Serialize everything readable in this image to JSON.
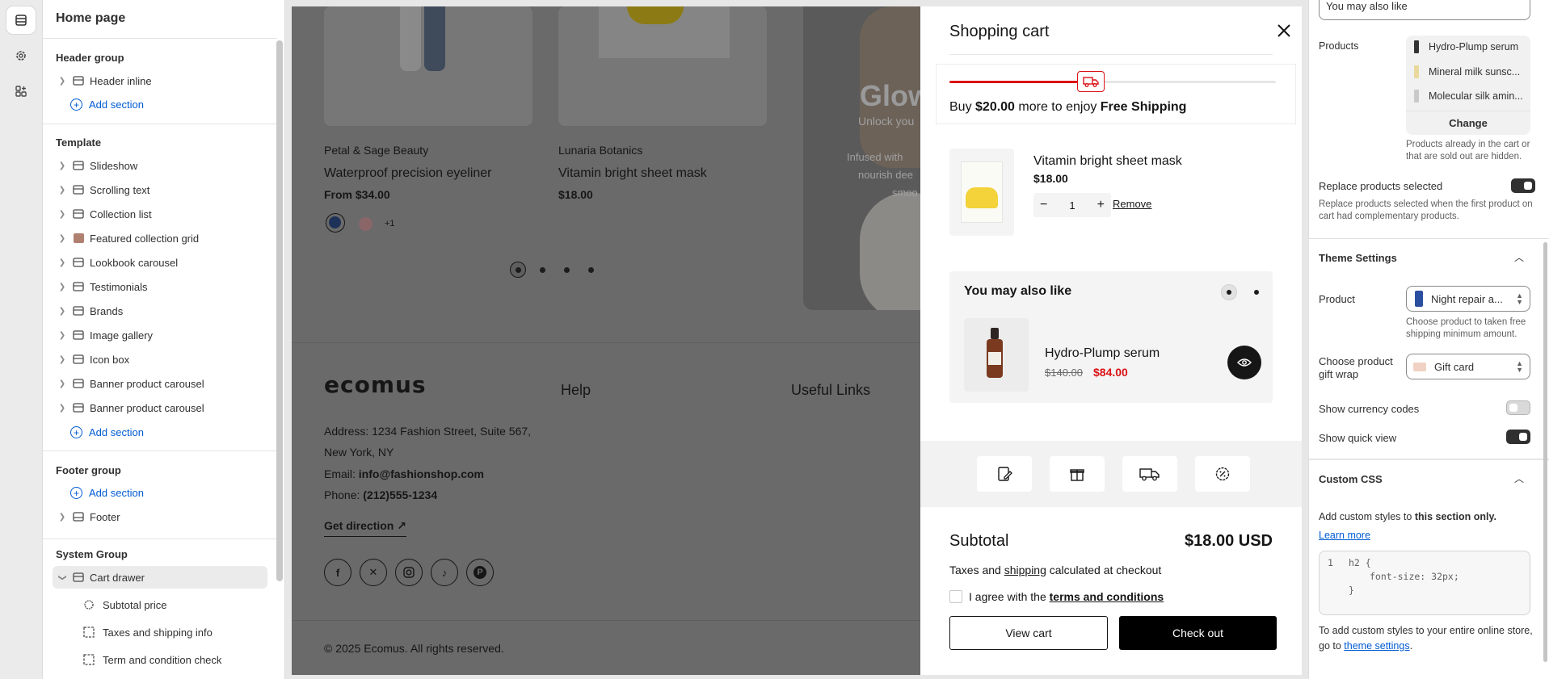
{
  "sidebar": {
    "title": "Home page",
    "header_group": {
      "title": "Header group",
      "items": [
        "Header inline"
      ],
      "add": "Add section"
    },
    "template": {
      "title": "Template",
      "items": [
        "Slideshow",
        "Scrolling text",
        "Collection list",
        "Featured collection grid",
        "Lookbook carousel",
        "Testimonials",
        "Brands",
        "Image gallery",
        "Icon box",
        "Banner product carousel",
        "Banner product carousel"
      ],
      "add": "Add section"
    },
    "footer_group": {
      "title": "Footer group",
      "add": "Add section",
      "items": [
        "Footer"
      ]
    },
    "system_group": {
      "title": "System Group",
      "selected": "Cart drawer",
      "children": [
        "Subtotal price",
        "Taxes and shipping info",
        "Term and condition check"
      ]
    }
  },
  "store": {
    "products": [
      {
        "brand": "Petal & Sage Beauty",
        "name": "Waterproof precision eyeliner",
        "price": "From $34.00",
        "more_swatches": "+1"
      },
      {
        "brand": "Lunaria Botanics",
        "name": "Vitamin bright sheet mask",
        "price": "$18.00"
      }
    ],
    "banner": {
      "title": "Glow",
      "line1": "Unlock you",
      "line2": "Infused with",
      "line3": "nourish dee",
      "line4": "smoo"
    },
    "footer": {
      "logo": "ecomus",
      "help_heading": "Help",
      "links_heading": "Useful Links",
      "address_line1": "Address: 1234 Fashion Street, Suite 567,",
      "address_line2": "New York, NY",
      "email_label": "Email: ",
      "email": "info@fashionshop.com",
      "phone_label": "Phone: ",
      "phone": "(212)555-1234",
      "direction": "Get direction",
      "copyright": "© 2025 Ecomus. All rights reserved."
    }
  },
  "cart": {
    "title": "Shopping cart",
    "shipping_progress": 0.4,
    "shipping_msg_pre": "Buy ",
    "shipping_amount": "$20.00",
    "shipping_msg_mid": " more to enjoy ",
    "shipping_free": "Free Shipping",
    "item": {
      "name": "Vitamin bright sheet mask",
      "price": "$18.00",
      "qty": "1",
      "remove": "Remove"
    },
    "upsell": {
      "title": "You may also like",
      "product": "Hydro-Plump serum",
      "old_price": "$140.00",
      "price": "$84.00"
    },
    "subtotal_label": "Subtotal",
    "subtotal_value": "$18.00 USD",
    "taxes_pre": "Taxes and ",
    "taxes_link": "shipping",
    "taxes_post": " calculated at checkout",
    "agree_pre": "I agree with the ",
    "agree_link": "terms and conditions",
    "view_cart": "View cart",
    "checkout": "Check out"
  },
  "settings": {
    "heading_input": "You may also like",
    "products_label": "Products",
    "products": [
      "Hydro-Plump serum",
      "Mineral milk sunsc...",
      "Molecular silk amin..."
    ],
    "change": "Change",
    "products_help": "Products already in the cart or that are sold out are hidden.",
    "replace_label": "Replace products selected",
    "replace_help": "Replace products selected when the first product on cart had complementary products.",
    "theme_title": "Theme Settings",
    "product_label": "Product",
    "product_value": "Night repair a...",
    "product_help": "Choose product to taken free shipping minimum amount.",
    "gift_label": "Choose product gift wrap",
    "gift_value": "Gift card",
    "currency_label": "Show currency codes",
    "quickview_label": "Show quick view",
    "css_title": "Custom CSS",
    "css_help_pre": "Add custom styles to ",
    "css_help_bold": "this section only.",
    "learn_more": "Learn more",
    "code_l1_num": "1",
    "code_l1": "h2 {",
    "code_l2": "font-size: 32px;",
    "code_l3": "}",
    "css_footer_pre": "To add custom styles to your entire online store, go to ",
    "css_footer_link": "theme settings",
    "css_footer_post": "."
  }
}
